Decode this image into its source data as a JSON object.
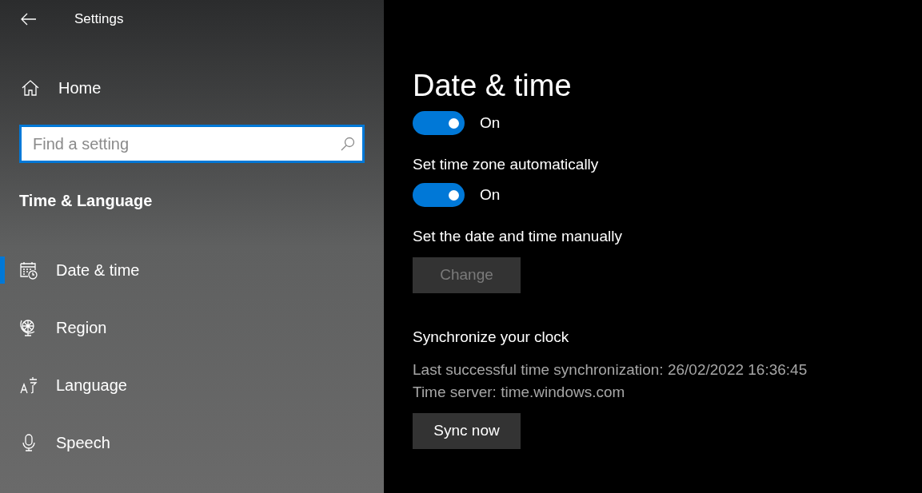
{
  "window": {
    "title": "Settings"
  },
  "sidebar": {
    "home": "Home",
    "search": {
      "placeholder": "Find a setting"
    },
    "section": "Time & Language",
    "items": [
      {
        "label": "Date & time",
        "kind": "calendar",
        "selected": true
      },
      {
        "label": "Region",
        "kind": "globe",
        "selected": false
      },
      {
        "label": "Language",
        "kind": "language",
        "selected": false
      },
      {
        "label": "Speech",
        "kind": "microphone",
        "selected": false
      }
    ]
  },
  "page": {
    "title": "Date & time",
    "settings": [
      {
        "kind": "toggle",
        "on": true,
        "state_label": "On"
      },
      {
        "kind": "label",
        "text": "Set time zone automatically"
      },
      {
        "kind": "toggle",
        "on": true,
        "state_label": "On"
      },
      {
        "kind": "label",
        "text": "Set the date and time manually"
      },
      {
        "kind": "button",
        "label": "Change",
        "disabled": true
      },
      {
        "kind": "heading",
        "text": "Synchronize your clock"
      },
      {
        "kind": "info",
        "text": "Last successful time synchronization: 26/02/2022 16:36:45"
      },
      {
        "kind": "info",
        "text": "Time server: time.windows.com"
      },
      {
        "kind": "button",
        "label": "Sync now",
        "disabled": false
      }
    ]
  }
}
